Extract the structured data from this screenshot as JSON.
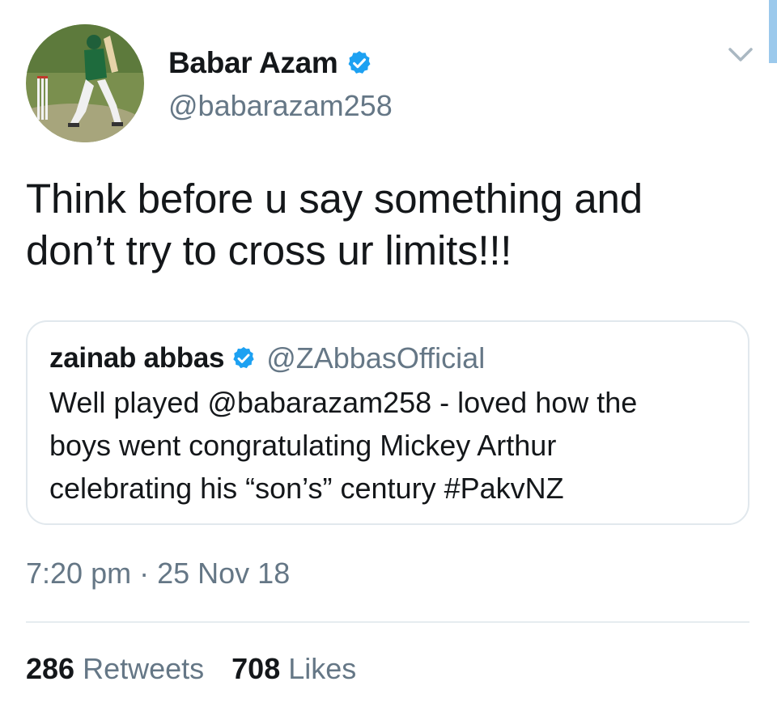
{
  "author": {
    "name": "Babar Azam",
    "handle": "@babarazam258",
    "avatar_icon": "cricketer-batting-avatar"
  },
  "tweet": {
    "text_line1": "Think before u say something and",
    "text_line2": "don’t try to cross ur limits!!!"
  },
  "quoted_tweet": {
    "name": "zainab abbas",
    "handle": "@ZAbbasOfficial",
    "text_line1": "Well played @babarazam258 - loved how the",
    "text_line2": "boys went congratulating Mickey Arthur",
    "text_line3": "celebrating his “son’s” century #PakvNZ"
  },
  "meta": {
    "time": "7:20 pm",
    "separator": "·",
    "date": "25 Nov 18"
  },
  "stats": {
    "retweets_count": "286",
    "retweets_label": "Retweets",
    "likes_count": "708",
    "likes_label": "Likes"
  },
  "colors": {
    "verified_blue": "#1da1f2",
    "secondary_text": "#657786",
    "primary_text": "#14171a",
    "border": "#e1e8ed"
  }
}
